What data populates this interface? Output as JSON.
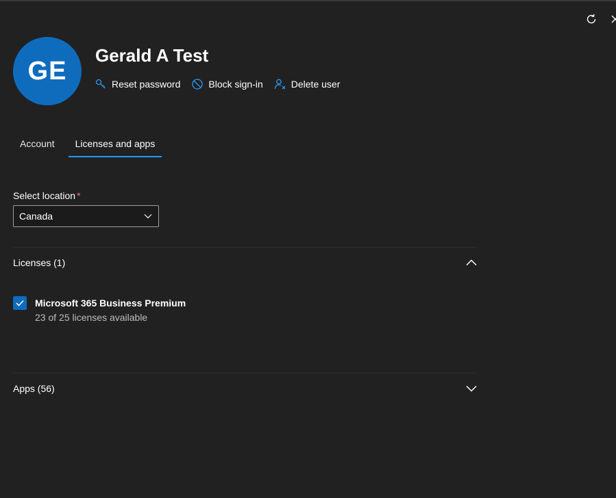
{
  "user": {
    "initials": "GE",
    "name": "Gerald A Test",
    "avatar_color": "#0f6cbd"
  },
  "actions": [
    {
      "label": "Reset password",
      "icon": "key-icon"
    },
    {
      "label": "Block sign-in",
      "icon": "block-icon"
    },
    {
      "label": "Delete user",
      "icon": "delete-user-icon"
    }
  ],
  "tabs": [
    {
      "label": "Account",
      "active": false
    },
    {
      "label": "Licenses and apps",
      "active": true
    }
  ],
  "location": {
    "label": "Select location",
    "required_mark": "*",
    "value": "Canada"
  },
  "licenses": {
    "header": "Licenses (1)",
    "expanded": true,
    "items": [
      {
        "name": "Microsoft 365 Business Premium",
        "availability": "23 of 25 licenses available",
        "checked": true
      }
    ]
  },
  "apps": {
    "header": "Apps (56)",
    "expanded": false
  },
  "colors": {
    "accent": "#2899f5",
    "checkbox": "#0f6cbd",
    "background": "#212121",
    "required": "#f1707b"
  }
}
